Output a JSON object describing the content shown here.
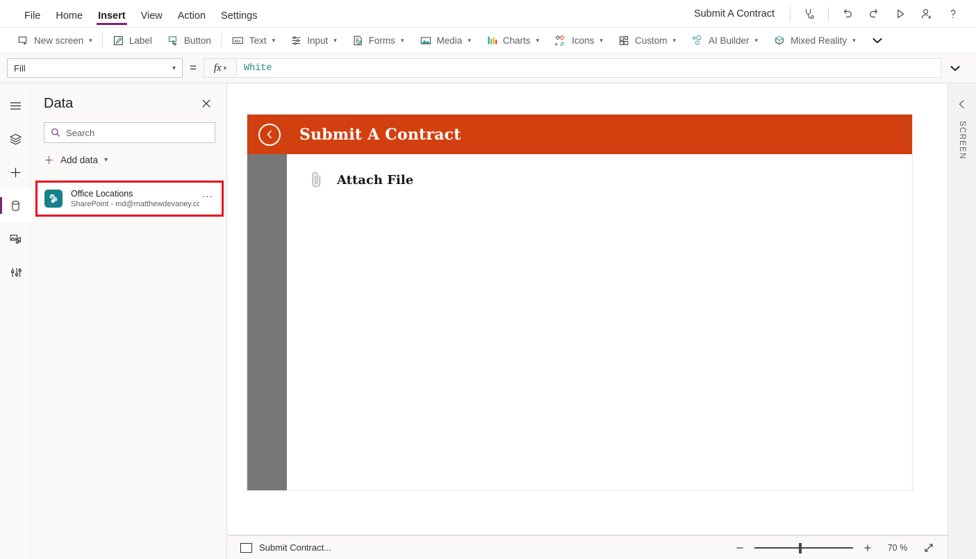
{
  "menu": {
    "items": [
      {
        "label": "File",
        "active": false
      },
      {
        "label": "Home",
        "active": false
      },
      {
        "label": "Insert",
        "active": true
      },
      {
        "label": "View",
        "active": false
      },
      {
        "label": "Action",
        "active": false
      },
      {
        "label": "Settings",
        "active": false
      }
    ],
    "app_name": "Submit A Contract",
    "actions": [
      {
        "name": "app-checker-icon",
        "title": "App checker"
      },
      {
        "name": "undo-icon",
        "title": "Undo"
      },
      {
        "name": "redo-icon",
        "title": "Redo"
      },
      {
        "name": "play-preview-icon",
        "title": "Preview the app"
      },
      {
        "name": "share-user-icon",
        "title": "Share"
      },
      {
        "name": "help-icon",
        "title": "Help"
      }
    ]
  },
  "ribbon": {
    "items": [
      {
        "label": "New screen",
        "icon": "new-screen-icon",
        "caret": true
      },
      {
        "label": "Label",
        "icon": "label-icon",
        "caret": false
      },
      {
        "label": "Button",
        "icon": "button-icon",
        "caret": false
      },
      {
        "label": "Text",
        "icon": "text-icon",
        "caret": true
      },
      {
        "label": "Input",
        "icon": "input-icon",
        "caret": true
      },
      {
        "label": "Forms",
        "icon": "forms-icon",
        "caret": true
      },
      {
        "label": "Media",
        "icon": "media-icon",
        "caret": true
      },
      {
        "label": "Charts",
        "icon": "charts-icon",
        "caret": true
      },
      {
        "label": "Icons",
        "icon": "icons-icon",
        "caret": true
      },
      {
        "label": "Custom",
        "icon": "custom-icon",
        "caret": true
      },
      {
        "label": "AI Builder",
        "icon": "ai-builder-icon",
        "caret": true
      },
      {
        "label": "Mixed Reality",
        "icon": "mixed-reality-icon",
        "caret": true
      }
    ],
    "overflow_label": "More"
  },
  "formula_bar": {
    "property": "Fill",
    "equals": "=",
    "fx_label": "fx",
    "formula": "White"
  },
  "rail": {
    "items": [
      {
        "name": "hamburger-menu-icon",
        "label": "Menu",
        "active": false
      },
      {
        "name": "tree-view-icon",
        "label": "Tree view",
        "active": false
      },
      {
        "name": "insert-plus-icon",
        "label": "Insert",
        "active": false
      },
      {
        "name": "data-sources-icon",
        "label": "Data",
        "active": true
      },
      {
        "name": "media-icon",
        "label": "Media",
        "active": false
      },
      {
        "name": "advanced-tools-icon",
        "label": "Advanced tools",
        "active": false
      }
    ]
  },
  "data_panel": {
    "title": "Data",
    "close_label": "Close",
    "search_placeholder": "Search",
    "search_value": "",
    "add_data_label": "Add data",
    "sources": [
      {
        "name": "Office Locations",
        "subtitle": "SharePoint - md@matthewdevaney.com",
        "icon": "sharepoint-icon",
        "more_label": "...",
        "highlight_color": "#e81123",
        "selected": true
      }
    ]
  },
  "canvas": {
    "app_screen": {
      "header_title": "Submit A Contract",
      "header_color": "#D2400F",
      "back_icon": "back-circle-icon",
      "sidebar_color": "#767676",
      "attach_label": "Attach File",
      "attach_icon": "paperclip-icon"
    }
  },
  "right_panel": {
    "label": "SCREEN",
    "expand_icon": "chevron-left-icon"
  },
  "bottom_bar": {
    "screen_name": "Submit Contract...",
    "zoom_out_label": "−",
    "zoom_in_label": "+",
    "zoom_value": "70",
    "zoom_unit": "%",
    "fit_icon": "fit-to-screen-icon"
  }
}
